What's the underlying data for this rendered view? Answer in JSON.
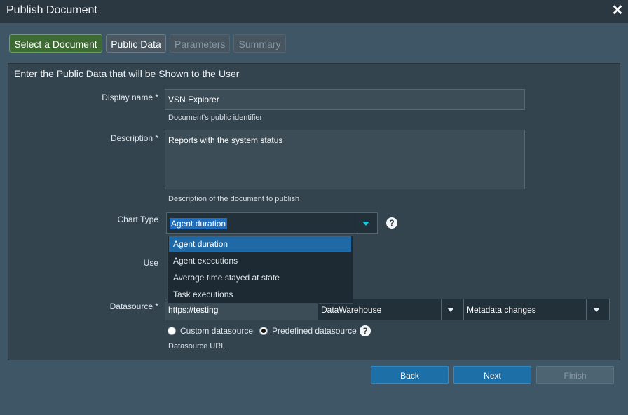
{
  "window": {
    "title": "Publish Document",
    "close_icon": "close-icon"
  },
  "tabs": [
    {
      "label": "Select a Document",
      "state": "completed"
    },
    {
      "label": "Public Data",
      "state": "active"
    },
    {
      "label": "Parameters",
      "state": "disabled"
    },
    {
      "label": "Summary",
      "state": "disabled"
    }
  ],
  "panel": {
    "heading": "Enter the Public Data that will be Shown to the User"
  },
  "form": {
    "display_name": {
      "label": "Display name *",
      "value": "VSN Explorer",
      "help": "Document's public identifier"
    },
    "description": {
      "label": "Description *",
      "value": "Reports with the system status",
      "help": "Description of the document to publish"
    },
    "chart_type": {
      "label": "Chart Type",
      "selected": "Agent duration",
      "options": [
        "Agent duration",
        "Agent executions",
        "Average time stayed at state",
        "Task executions"
      ]
    },
    "use": {
      "label": "Use"
    },
    "datasource": {
      "label": "Datasource *",
      "url_value": "https://testing",
      "warehouse": "DataWarehouse",
      "metadata": "Metadata changes",
      "radio_custom": "Custom datasource",
      "radio_predefined": "Predefined datasource",
      "selected_radio": "Predefined datasource",
      "help": "Datasource URL"
    }
  },
  "buttons": {
    "back": "Back",
    "next": "Next",
    "finish": "Finish"
  },
  "colors": {
    "accent": "#1d6fa8",
    "tab_completed": "#3d6b33",
    "dropdown_caret": "#22c8d8"
  }
}
